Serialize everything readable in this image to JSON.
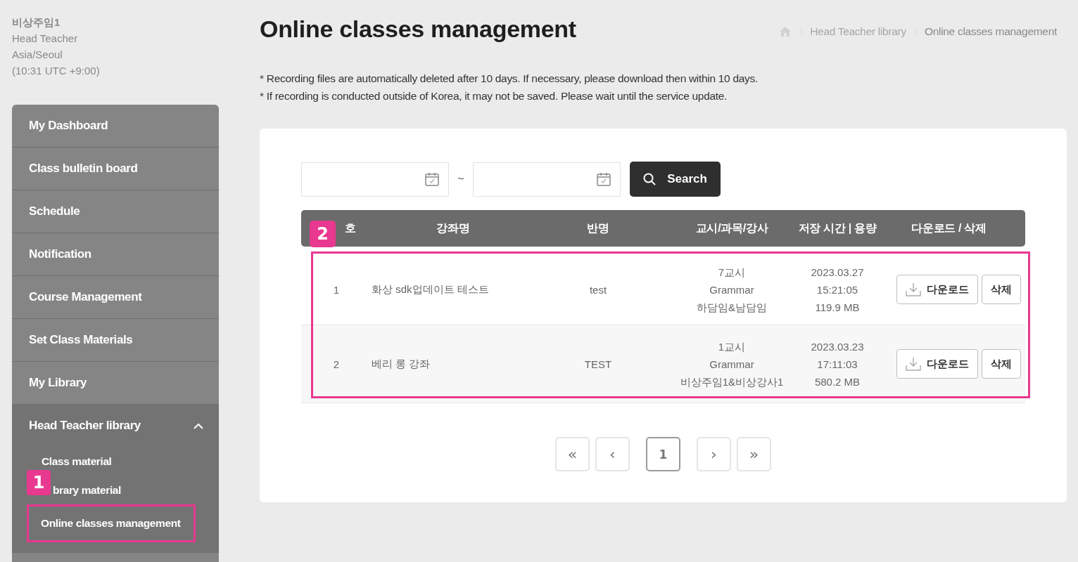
{
  "user": {
    "name": "비상주임1",
    "role": "Head Teacher",
    "timezone": "Asia/Seoul",
    "time": "(10:31 UTC +9:00)"
  },
  "sidebar": {
    "items": [
      {
        "label": "My Dashboard"
      },
      {
        "label": "Class bulletin board"
      },
      {
        "label": "Schedule"
      },
      {
        "label": "Notification"
      },
      {
        "label": "Course Management"
      },
      {
        "label": "Set Class Materials"
      },
      {
        "label": "My Library"
      },
      {
        "label": "Head Teacher library",
        "expanded": true,
        "children": [
          {
            "label": "Class material",
            "highlighted": false
          },
          {
            "label": "brary material",
            "highlighted": false,
            "badge": "1"
          },
          {
            "label": "Online classes management",
            "highlighted": true
          }
        ]
      }
    ]
  },
  "page": {
    "title": "Online classes management",
    "breadcrumb": [
      "Head Teacher library",
      "Online classes management"
    ],
    "notes": [
      "* Recording files are automatically deleted after 10 days. If necessary, please download then within 10 days.",
      "* If recording is conducted outside of Korea, it may not be saved. Please wait until the service update."
    ]
  },
  "filters": {
    "search_button": "Search",
    "separator": "~"
  },
  "table": {
    "badge": "2",
    "columns": [
      "호",
      "강좌명",
      "반명",
      "교시/과목/강사",
      "저장 시간 | 용량",
      "다운로드 / 삭제"
    ],
    "rows_highlighted": true,
    "rows": [
      {
        "no": "1",
        "course": "화상 sdk업데이트 테스트",
        "class": "test",
        "period": [
          "7교시",
          "Grammar",
          "하담임&남담임"
        ],
        "saved": [
          "2023.03.27",
          "15:21:05",
          "119.9 MB"
        ],
        "download": "다운로드",
        "delete": "삭제"
      },
      {
        "no": "2",
        "course": "베리 롱 강좌",
        "class": "TEST",
        "period": [
          "1교시",
          "Grammar",
          "비상주임1&비상강사1"
        ],
        "saved": [
          "2023.03.23",
          "17:11:03",
          "580.2 MB"
        ],
        "download": "다운로드",
        "delete": "삭제"
      }
    ]
  },
  "pagination": [
    {
      "label": "«",
      "kind": "first",
      "selected": false
    },
    {
      "label": "‹",
      "kind": "prev",
      "selected": false
    },
    {
      "label": "1",
      "kind": "page",
      "selected": true
    },
    {
      "label": "›",
      "kind": "next",
      "selected": false
    },
    {
      "label": "»",
      "kind": "last",
      "selected": false
    }
  ]
}
